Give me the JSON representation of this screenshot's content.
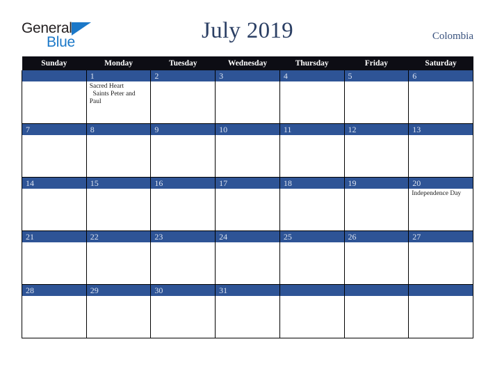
{
  "brand": {
    "word1": "General",
    "word2": "Blue",
    "triangle_icon": "brand-triangle-icon",
    "color_dark": "#231f20",
    "color_blue": "#1b78c8"
  },
  "header": {
    "title": "July 2019",
    "country": "Colombia",
    "title_color": "#2b3f64",
    "country_color": "#37507c"
  },
  "calendar": {
    "weekdays": [
      "Sunday",
      "Monday",
      "Tuesday",
      "Wednesday",
      "Thursday",
      "Friday",
      "Saturday"
    ],
    "header_bg": "#0d0d14",
    "daybar_bg": "#2e5496",
    "daynum_color": "#dbe2ef",
    "weeks": [
      [
        {
          "day": "",
          "holidays": []
        },
        {
          "day": "1",
          "holidays": [
            "Sacred Heart",
            "  Saints Peter and Paul"
          ]
        },
        {
          "day": "2",
          "holidays": []
        },
        {
          "day": "3",
          "holidays": []
        },
        {
          "day": "4",
          "holidays": []
        },
        {
          "day": "5",
          "holidays": []
        },
        {
          "day": "6",
          "holidays": []
        }
      ],
      [
        {
          "day": "7",
          "holidays": []
        },
        {
          "day": "8",
          "holidays": []
        },
        {
          "day": "9",
          "holidays": []
        },
        {
          "day": "10",
          "holidays": []
        },
        {
          "day": "11",
          "holidays": []
        },
        {
          "day": "12",
          "holidays": []
        },
        {
          "day": "13",
          "holidays": []
        }
      ],
      [
        {
          "day": "14",
          "holidays": []
        },
        {
          "day": "15",
          "holidays": []
        },
        {
          "day": "16",
          "holidays": []
        },
        {
          "day": "17",
          "holidays": []
        },
        {
          "day": "18",
          "holidays": []
        },
        {
          "day": "19",
          "holidays": []
        },
        {
          "day": "20",
          "holidays": [
            "Independence Day"
          ]
        }
      ],
      [
        {
          "day": "21",
          "holidays": []
        },
        {
          "day": "22",
          "holidays": []
        },
        {
          "day": "23",
          "holidays": []
        },
        {
          "day": "24",
          "holidays": []
        },
        {
          "day": "25",
          "holidays": []
        },
        {
          "day": "26",
          "holidays": []
        },
        {
          "day": "27",
          "holidays": []
        }
      ],
      [
        {
          "day": "28",
          "holidays": []
        },
        {
          "day": "29",
          "holidays": []
        },
        {
          "day": "30",
          "holidays": []
        },
        {
          "day": "31",
          "holidays": []
        },
        {
          "day": "",
          "holidays": []
        },
        {
          "day": "",
          "holidays": []
        },
        {
          "day": "",
          "holidays": []
        }
      ]
    ]
  }
}
